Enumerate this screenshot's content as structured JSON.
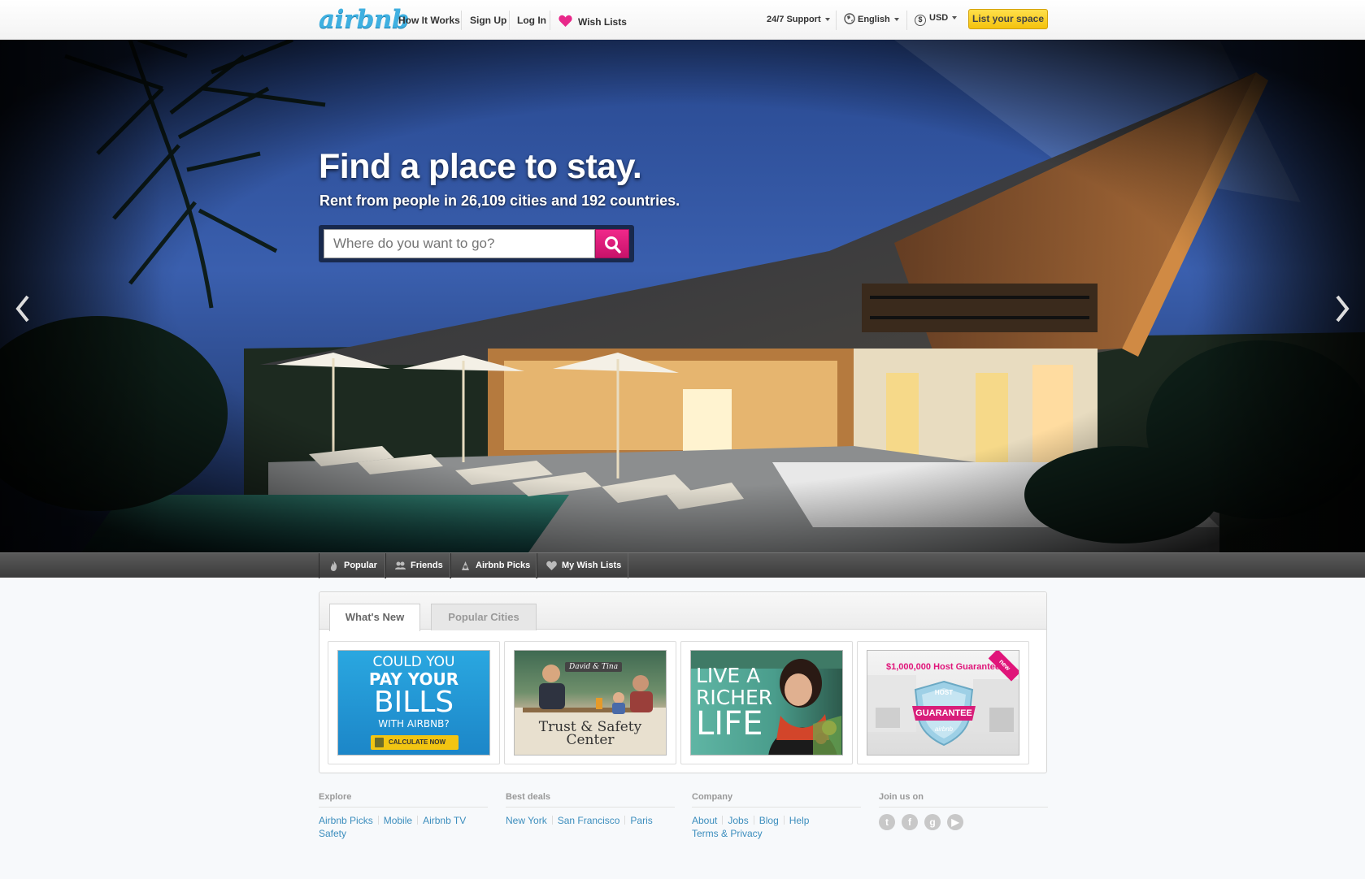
{
  "header": {
    "logo": "airbnb",
    "nav": [
      "How It Works",
      "Sign Up",
      "Log In",
      "Wish Lists"
    ],
    "support": "24/7 Support",
    "language": "English",
    "currency": "USD",
    "list_space": "List your space"
  },
  "hero": {
    "title": "Find a place to stay.",
    "subtitle": "Rent from people in 26,109 cities and 192 countries.",
    "search_placeholder": "Where do you want to go?"
  },
  "subnav": [
    "Popular",
    "Friends",
    "Airbnb Picks",
    "My Wish Lists"
  ],
  "tabs": [
    "What's New",
    "Popular Cities"
  ],
  "cards": {
    "bills": {
      "line1": "COULD YOU",
      "line2": "PAY YOUR",
      "line3": "BILLS",
      "line4": "WITH AIRBNB?",
      "cta": "CALCULATE NOW"
    },
    "trust": {
      "tag": "David & Tina",
      "line1": "Trust & Safety",
      "line2": "Center"
    },
    "richer": {
      "line1": "LIVE A",
      "line2": "RICHER",
      "line3": "LIFE"
    },
    "guarantee": {
      "title": "$1,000,000 Host Guarantee",
      "badge_top": "HOST",
      "badge_main": "GUARANTEE",
      "badge_bottom": "airbnb",
      "ribbon": "new"
    }
  },
  "footer": {
    "explore": {
      "heading": "Explore",
      "links": [
        "Airbnb Picks",
        "Mobile",
        "Airbnb TV",
        "Safety"
      ]
    },
    "deals": {
      "heading": "Best deals",
      "links": [
        "New York",
        "San Francisco",
        "Paris"
      ]
    },
    "company": {
      "heading": "Company",
      "links": [
        "About",
        "Jobs",
        "Blog",
        "Help",
        "Terms & Privacy"
      ]
    },
    "join": {
      "heading": "Join us on",
      "icons": [
        "twitter-icon",
        "facebook-icon",
        "google-plus-icon",
        "youtube-icon"
      ]
    }
  },
  "colors": {
    "brand_blue": "#3fb0e1",
    "search_pink": "#e0157a",
    "list_yellow": "#f6c912",
    "link_blue": "#3b8dbd"
  }
}
